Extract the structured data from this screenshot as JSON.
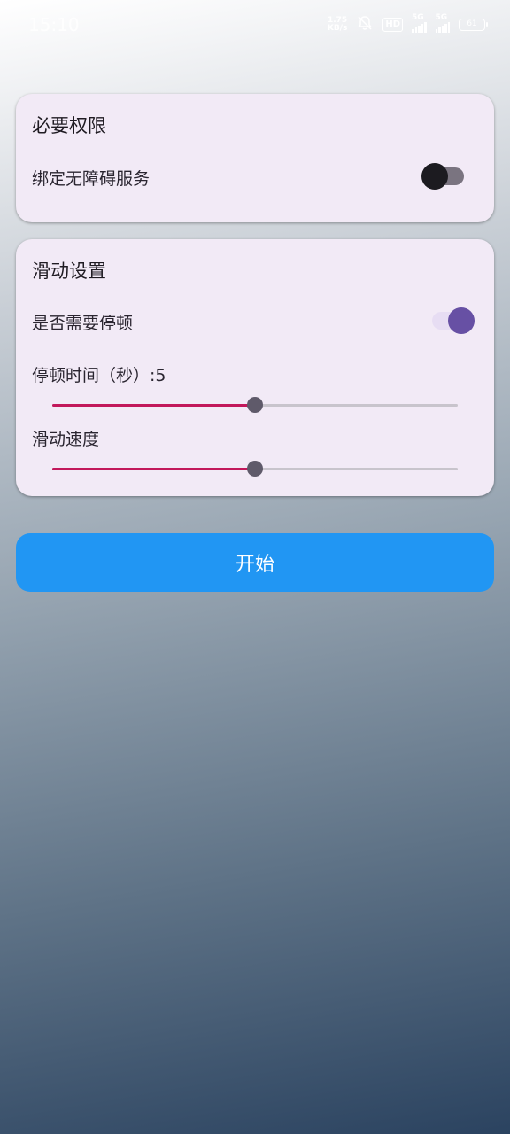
{
  "status_bar": {
    "time": "15:10",
    "net_speed_value": "1.75",
    "net_speed_unit": "KB/s",
    "hd_label": "HD",
    "signal1_label": "5G",
    "signal2_label": "5G",
    "battery": "61",
    "icons": [
      "bell-off-icon",
      "hd-icon",
      "signal-icon",
      "signal-icon",
      "battery-icon"
    ]
  },
  "permissions_card": {
    "title": "必要权限",
    "accessibility_label": "绑定无障碍服务",
    "accessibility_enabled": false
  },
  "swipe_card": {
    "title": "滑动设置",
    "pause_label": "是否需要停顿",
    "pause_enabled": true,
    "pause_time_label": "停顿时间（秒）:5",
    "pause_time_fraction": 0.5,
    "speed_label": "滑动速度",
    "speed_fraction": 0.5
  },
  "start_button": {
    "label": "开始"
  },
  "colors": {
    "card_bg": "#f2eaf6",
    "slider_active": "#c2185b",
    "switch_on": "#6750a4",
    "button_bg": "#2196f3"
  }
}
